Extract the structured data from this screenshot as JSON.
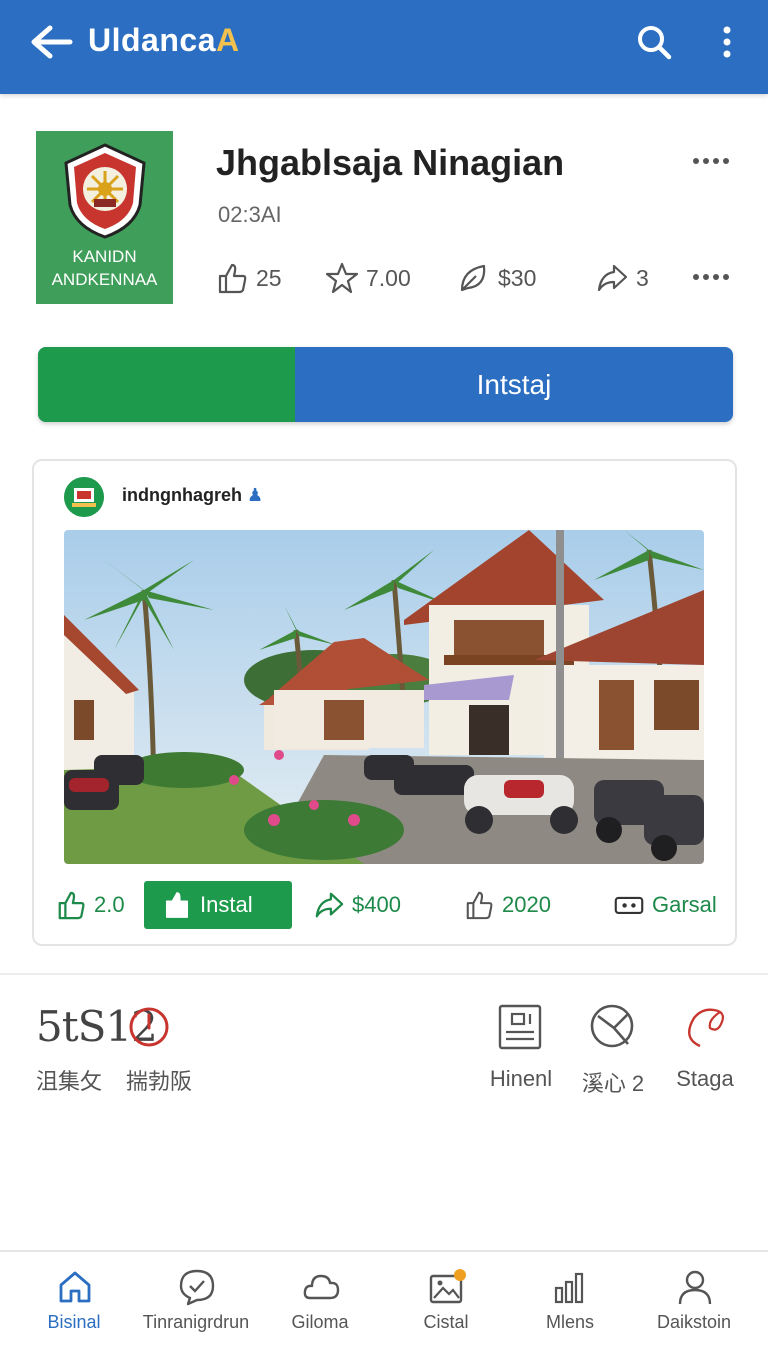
{
  "header": {
    "title": "Uldanca",
    "title_accent": "A",
    "back_icon": "arrow-left-icon",
    "search_icon": "search-icon",
    "menu_icon": "kebab-menu-icon",
    "color": "#2b6ec2"
  },
  "app": {
    "icon_text": "KANIDN ANDKENNAA",
    "title": "Jhgablsaja Ninagian",
    "time": "02:3AI",
    "stats": [
      {
        "icon": "thumbs-up-icon",
        "value": "25"
      },
      {
        "icon": "star-icon",
        "value": "7.00"
      },
      {
        "icon": "leaf-icon",
        "value": "$30"
      },
      {
        "icon": "share-icon",
        "value": "3"
      }
    ],
    "install_label": "Intstaj",
    "install_green": "#1e9a4d"
  },
  "post": {
    "username": "indngnhagreh",
    "actions": [
      {
        "icon": "thumbs-up-icon",
        "label": "2.0"
      },
      {
        "icon": "install-icon",
        "label": "Instal"
      },
      {
        "icon": "share-icon",
        "label": "$400"
      },
      {
        "icon": "thumbs-up-icon",
        "label": "2020"
      },
      {
        "icon": "dots-box-icon",
        "label": "Garsal"
      }
    ]
  },
  "info": {
    "code": "5tS12",
    "cjk_left": "沮集攵",
    "cjk_right": "揣勃阪",
    "tools": [
      {
        "icon": "document-icon",
        "label": "Hinenl"
      },
      {
        "icon": "compass-icon",
        "label": "溪心 2"
      },
      {
        "icon": "ring-icon",
        "label": "Staga"
      }
    ]
  },
  "nav": [
    {
      "icon": "home-icon",
      "label": "Bisinal",
      "active": true
    },
    {
      "icon": "chat-check-icon",
      "label": "Tinranigrdrun"
    },
    {
      "icon": "cloud-icon",
      "label": "Giloma"
    },
    {
      "icon": "image-icon",
      "label": "Cistal",
      "badge": "F"
    },
    {
      "icon": "bar-chart-icon",
      "label": "Mlens"
    },
    {
      "icon": "person-icon",
      "label": "Daikstoin"
    }
  ]
}
